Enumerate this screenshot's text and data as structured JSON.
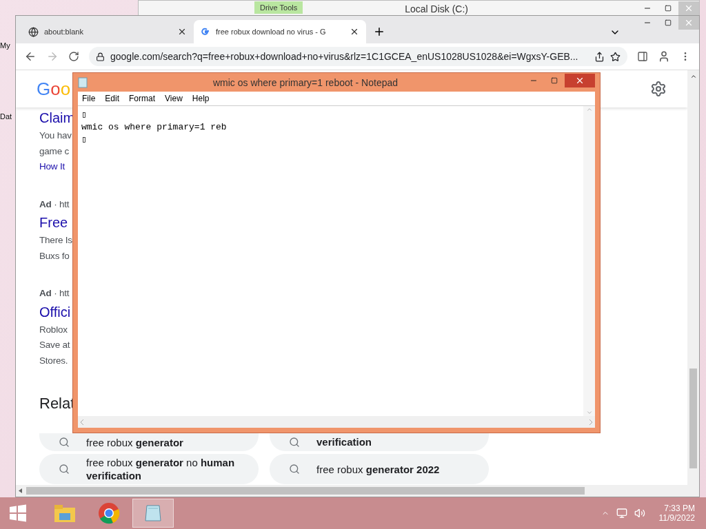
{
  "desktop_icons": [
    {
      "label": "My"
    },
    {
      "label": "Dat"
    }
  ],
  "explorer_window": {
    "ribbon_tab": "Drive Tools",
    "title": "Local Disk (C:)"
  },
  "browser": {
    "tabs": [
      {
        "title": "about:blank",
        "selected": false
      },
      {
        "title": "free robux download no virus - G",
        "selected": true
      }
    ],
    "address": "google.com/search?q=free+robux+download+no+virus&rlz=1C1GCEA_enUS1028US1028&ei=WgxsY-GEB...",
    "page": {
      "logo": "Goo",
      "results": [
        {
          "kind": "title",
          "text": "Claim"
        },
        {
          "kind": "snippet",
          "text": "You hav"
        },
        {
          "kind": "snippet",
          "text": "game c"
        },
        {
          "kind": "link",
          "text": "How It"
        },
        {
          "kind": "ad",
          "text": "**Ad** · htt"
        },
        {
          "kind": "title",
          "text": "Free"
        },
        {
          "kind": "snippet",
          "text": "There Is"
        },
        {
          "kind": "snippet",
          "text": "Buxs fo"
        },
        {
          "kind": "ad",
          "text": "**Ad** · htt"
        },
        {
          "kind": "title",
          "text": "Offici"
        },
        {
          "kind": "snippet",
          "text": "Roblox"
        },
        {
          "kind": "snippet",
          "text": "Save at"
        },
        {
          "kind": "snippet",
          "text": "Stores."
        }
      ],
      "related_heading": "Relat",
      "suggestions": [
        {
          "text": "free robux **generator**"
        },
        {
          "text": "**verification**"
        },
        {
          "text": "free robux **generator** no **human verification**"
        },
        {
          "text": "free robux **generator 2022**"
        }
      ]
    }
  },
  "notepad": {
    "title": "wmic os where primary=1 reboot - Notepad",
    "menu": [
      "File",
      "Edit",
      "Format",
      "View",
      "Help"
    ],
    "lines": [
      "▯",
      "wmic os where primary=1 reb",
      "▯"
    ]
  },
  "taskbar": {
    "apps": [
      {
        "kind": "explorer",
        "selected": false
      },
      {
        "kind": "chrome",
        "selected": false
      },
      {
        "kind": "notepad",
        "selected": true
      }
    ],
    "time": "7:33 PM",
    "date": "11/9/2022"
  }
}
